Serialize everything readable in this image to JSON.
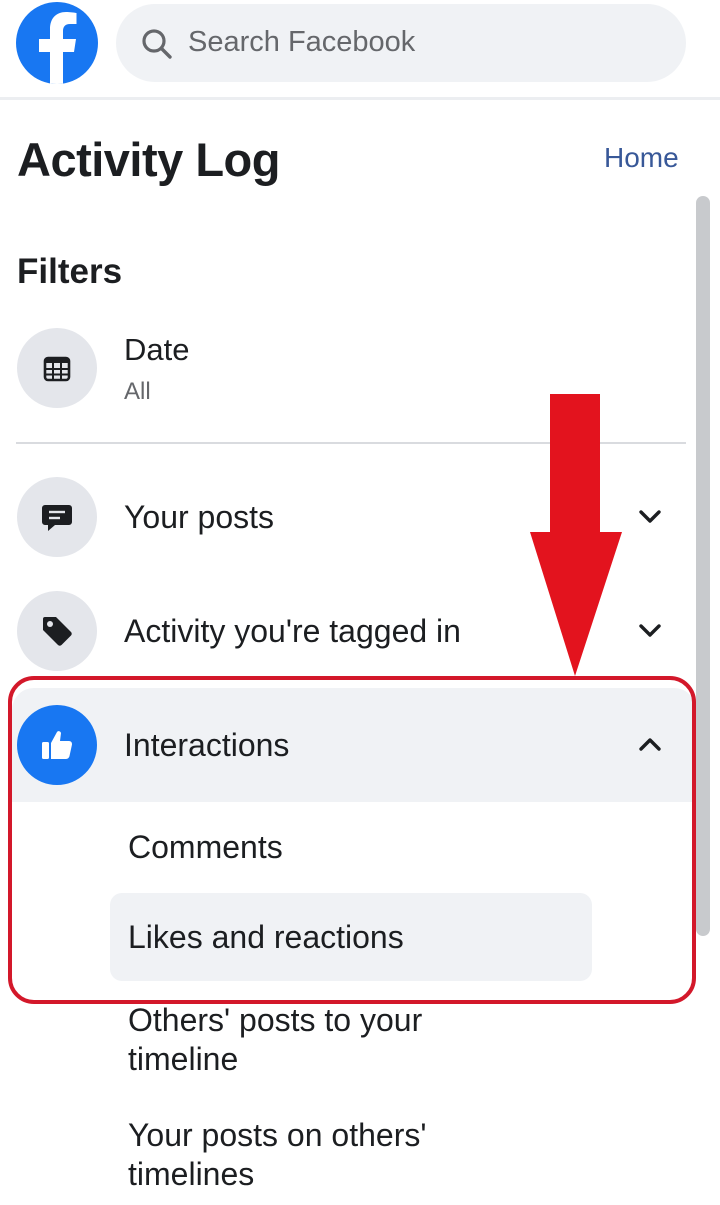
{
  "search": {
    "placeholder": "Search Facebook"
  },
  "header": {
    "title": "Activity Log",
    "home_link": "Home"
  },
  "filters": {
    "title": "Filters",
    "date": {
      "label": "Date",
      "value": "All",
      "icon": "calendar-icon"
    },
    "items": [
      {
        "label": "Your posts",
        "icon": "comment-icon",
        "expanded": false
      },
      {
        "label": "Activity you're tagged in",
        "icon": "tag-icon",
        "expanded": false
      },
      {
        "label": "Interactions",
        "icon": "thumbs-up-icon",
        "expanded": true
      }
    ],
    "interactions_sub": [
      "Comments",
      "Likes and reactions"
    ],
    "more": [
      {
        "line1": "Others' posts to your",
        "line2": "timeline"
      },
      {
        "line1": "Your posts on others'",
        "line2": "timelines"
      }
    ]
  },
  "colors": {
    "brand": "#1877f2",
    "link": "#385898",
    "highlight": "#d3182a",
    "arrow": "#e3131e",
    "row_bg": "#f0f2f5"
  }
}
